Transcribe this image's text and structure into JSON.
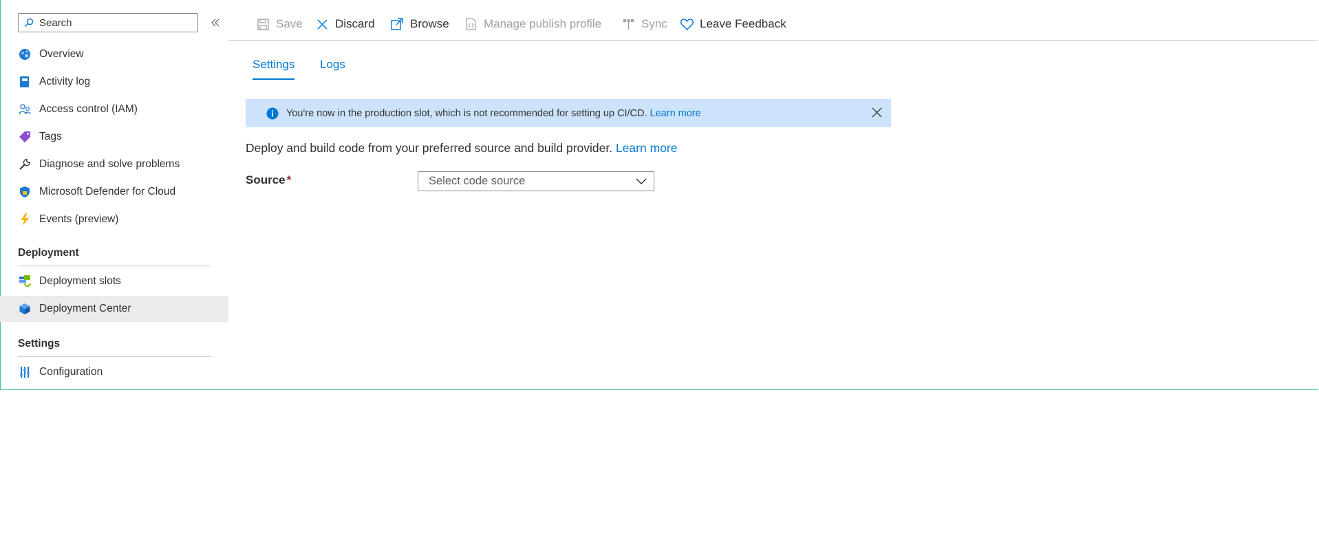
{
  "sidebar": {
    "search_placeholder": "Search",
    "items_top": [
      {
        "label": "Overview",
        "icon": "overview-icon"
      },
      {
        "label": "Activity log",
        "icon": "activity-log-icon"
      },
      {
        "label": "Access control (IAM)",
        "icon": "access-control-icon"
      },
      {
        "label": "Tags",
        "icon": "tag-icon"
      },
      {
        "label": "Diagnose and solve problems",
        "icon": "wrench-icon"
      },
      {
        "label": "Microsoft Defender for Cloud",
        "icon": "shield-icon"
      },
      {
        "label": "Events (preview)",
        "icon": "lightning-icon"
      }
    ],
    "sections": [
      {
        "title": "Deployment",
        "items": [
          {
            "label": "Deployment slots",
            "icon": "deployment-slots-icon"
          },
          {
            "label": "Deployment Center",
            "icon": "cube-icon",
            "active": true
          }
        ]
      },
      {
        "title": "Settings",
        "items": [
          {
            "label": "Configuration",
            "icon": "sliders-icon"
          }
        ]
      }
    ]
  },
  "toolbar": {
    "save": "Save",
    "discard": "Discard",
    "browse": "Browse",
    "manage_publish_profile": "Manage publish profile",
    "sync": "Sync",
    "leave_feedback": "Leave Feedback"
  },
  "tabs": [
    "Settings",
    "Logs"
  ],
  "selected_tab": "Settings",
  "banner": {
    "message": "You're now in the production slot, which is not recommended for setting up CI/CD.",
    "link": "Learn more"
  },
  "description": {
    "text": "Deploy and build code from your preferred source and build provider.",
    "link": "Learn more"
  },
  "source": {
    "label": "Source",
    "required_marker": "*",
    "select_value": "Select code source"
  },
  "colors": {
    "accent": "#0078d4",
    "banner_bg": "#cce3fb",
    "active_nav_bg": "#edebe9",
    "frame_border": "#3fc79e"
  }
}
